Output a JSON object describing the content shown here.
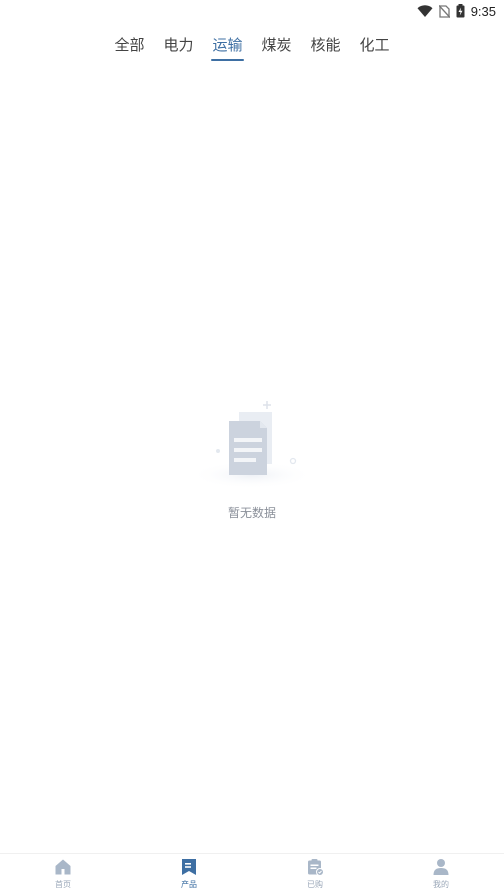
{
  "status_bar": {
    "time": "9:35",
    "icons": [
      "wifi-icon",
      "no-sim-icon",
      "battery-charging-icon"
    ]
  },
  "tabs": [
    {
      "label": "全部",
      "active": false
    },
    {
      "label": "电力",
      "active": false
    },
    {
      "label": "运输",
      "active": true
    },
    {
      "label": "煤炭",
      "active": false
    },
    {
      "label": "核能",
      "active": false
    },
    {
      "label": "化工",
      "active": false
    }
  ],
  "empty_state": {
    "icon": "document-stack-icon",
    "text": "暂无数据"
  },
  "bottom_nav": [
    {
      "label": "首页",
      "icon": "home-icon",
      "active": false
    },
    {
      "label": "产品",
      "icon": "bookmark-icon",
      "active": true
    },
    {
      "label": "已购",
      "icon": "purchased-list-icon",
      "active": false
    },
    {
      "label": "我的",
      "icon": "user-icon",
      "active": false
    }
  ],
  "colors": {
    "accent": "#3e6fa3",
    "inactive_nav": "#9aa7b8",
    "tab_text": "#444444",
    "empty_text": "#8a8f99"
  }
}
